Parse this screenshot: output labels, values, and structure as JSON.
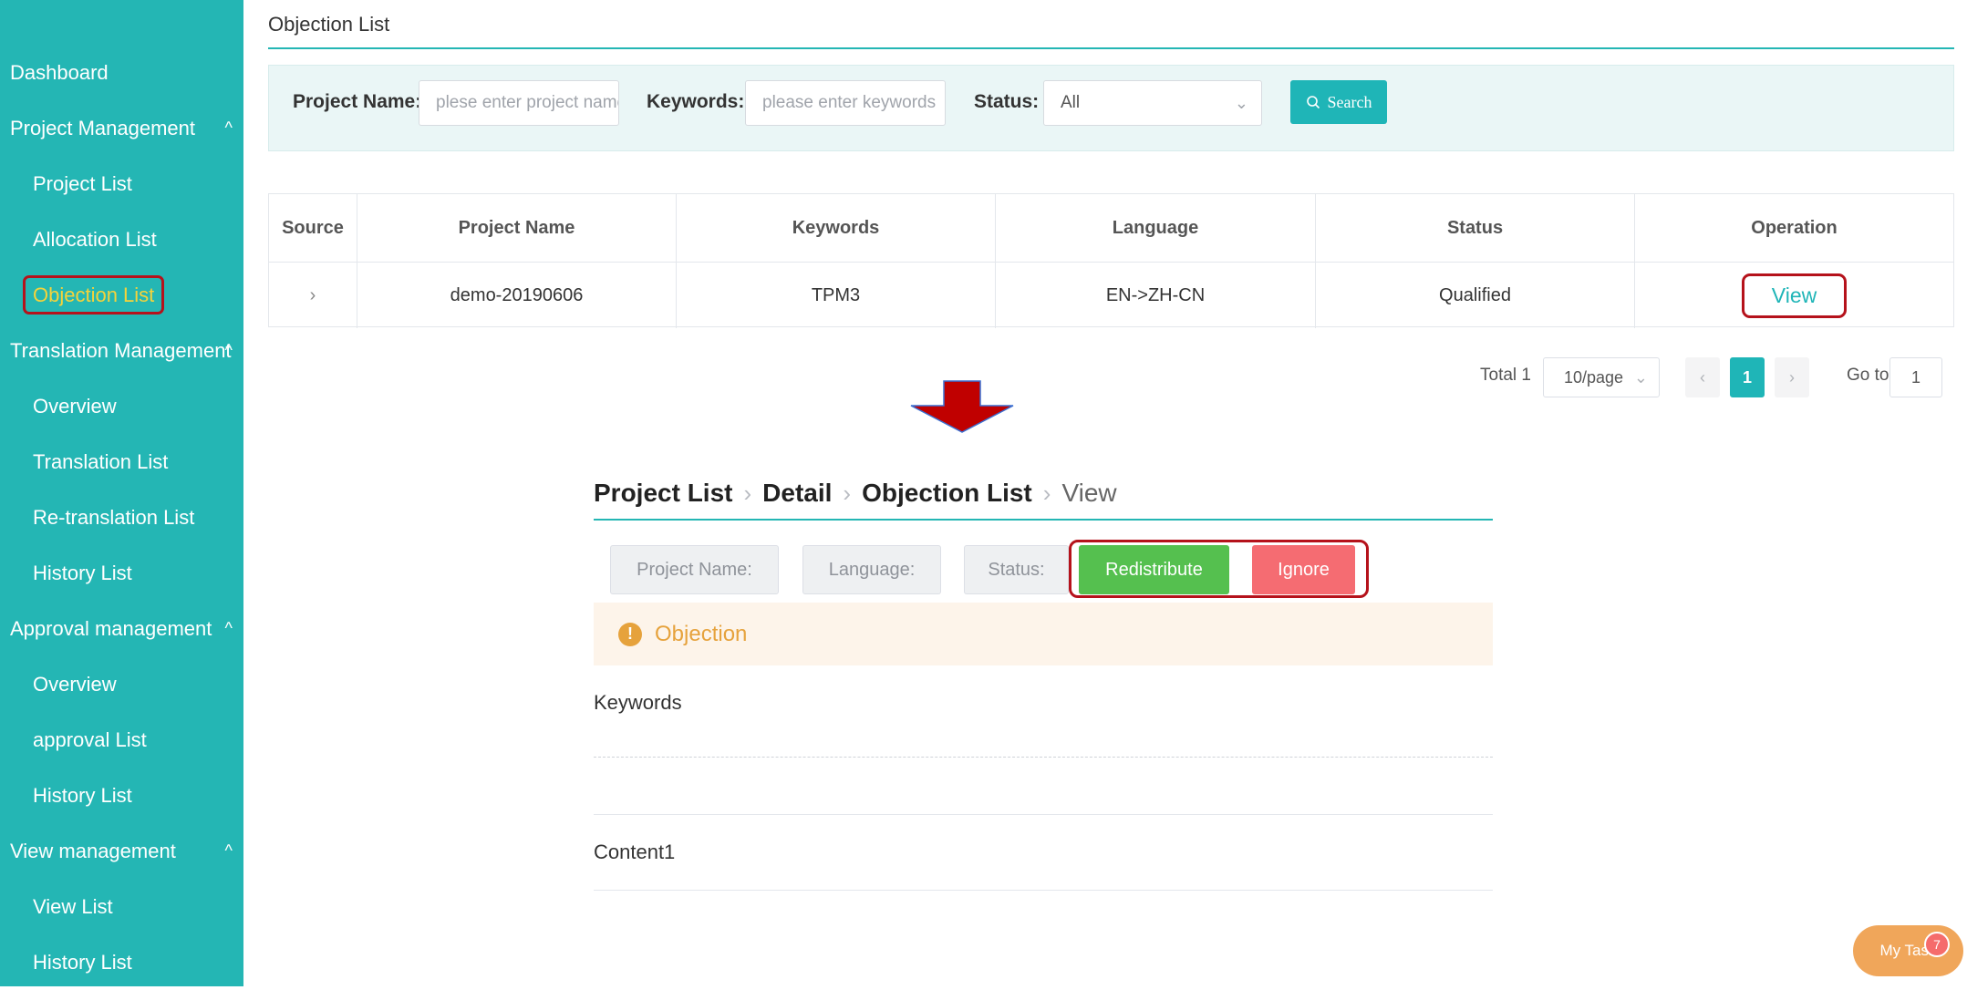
{
  "sidebar": {
    "items": [
      {
        "label": "Dashboard",
        "caret": ""
      },
      {
        "label": "Project Management",
        "caret": "^"
      },
      {
        "label": "Project List"
      },
      {
        "label": "Allocation List"
      },
      {
        "label": "Objection List"
      },
      {
        "label": "Translation Management",
        "caret": "^"
      },
      {
        "label": "Overview"
      },
      {
        "label": "Translation List"
      },
      {
        "label": "Re-translation List"
      },
      {
        "label": "History List"
      },
      {
        "label": "Approval management",
        "caret": "^"
      },
      {
        "label": "Overview"
      },
      {
        "label": "approval List"
      },
      {
        "label": "History List"
      },
      {
        "label": "View management",
        "caret": "^"
      },
      {
        "label": "View List"
      },
      {
        "label": "History List"
      }
    ],
    "active_color": "#f5d33a"
  },
  "page": {
    "title": "Objection List"
  },
  "filters": {
    "project_name_label": "Project Name:",
    "project_name_placeholder": "plese enter project name",
    "keywords_label": "Keywords:",
    "keywords_placeholder": "please enter keywords",
    "status_label": "Status:",
    "status_value": "All",
    "search_label": "Search"
  },
  "table": {
    "headers": [
      "Source",
      "Project Name",
      "Keywords",
      "Language",
      "Status",
      "Operation"
    ],
    "rows": [
      {
        "source": "›",
        "project_name": "demo-20190606",
        "keywords": "TPM3",
        "language": "EN->ZH-CN",
        "status": "Qualified",
        "operation": "View"
      }
    ]
  },
  "pagination": {
    "total": "Total 1",
    "page_size": "10/page",
    "current_page": "1",
    "goto_label": "Go to",
    "goto_value": "1"
  },
  "detail": {
    "breadcrumb": [
      "Project List",
      "Detail",
      "Objection List",
      "View"
    ],
    "project_name_label": "Project Name:",
    "language_label": "Language:",
    "status_label": "Status:",
    "redistribute_label": "Redistribute",
    "ignore_label": "Ignore",
    "objection_label": "Objection",
    "keywords_label": "Keywords",
    "content1_label": "Content1"
  },
  "mytask": {
    "label": "My Task",
    "count": "7"
  },
  "colors": {
    "accent": "#24b6b4",
    "highlight_border": "#b5121b",
    "redistribute": "#55c04f",
    "ignore": "#f56c72",
    "warning": "#e6a23c",
    "arrow": "#c00000"
  }
}
